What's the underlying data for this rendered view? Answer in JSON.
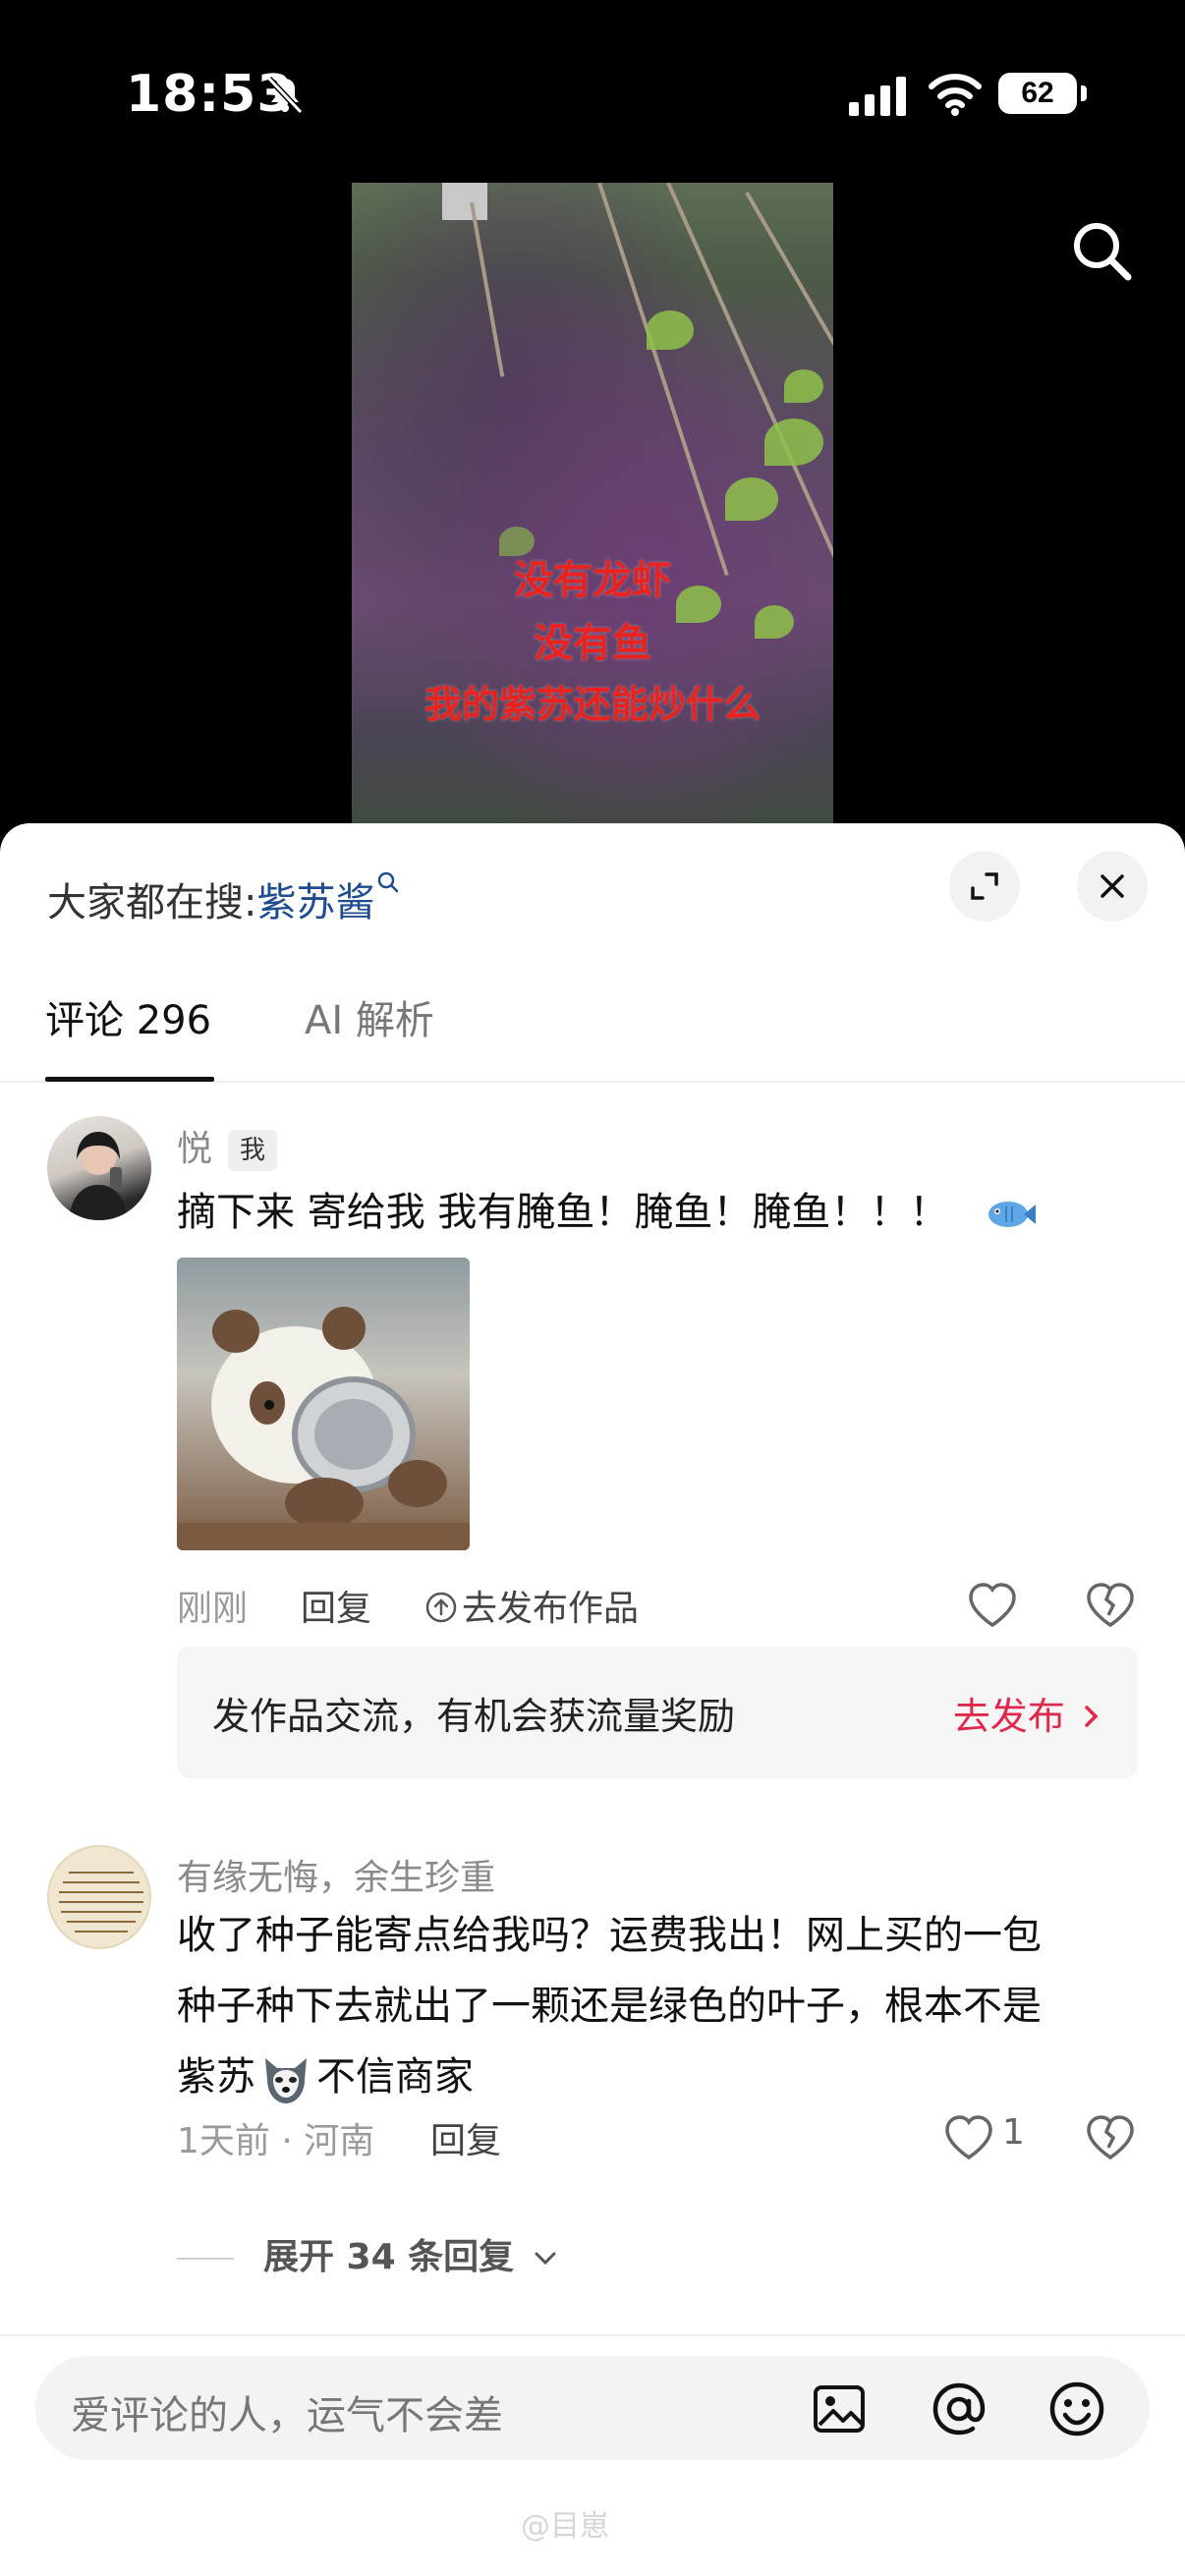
{
  "status_bar": {
    "time": "18:53",
    "battery": "62",
    "icons": [
      "bell-slash-icon",
      "cellular-signal-icon",
      "wifi-icon",
      "battery-icon"
    ]
  },
  "video": {
    "caption_lines": [
      "没有龙虾",
      "没有鱼",
      "我的紫苏还能炒什么"
    ],
    "search_icon": "search-icon"
  },
  "sheet": {
    "hot_search_label": "大家都在搜:",
    "hot_search_keyword": "紫苏酱",
    "expand_icon": "expand-icon",
    "close_icon": "close-icon"
  },
  "tabs": [
    {
      "label": "评论 296",
      "active": true
    },
    {
      "label": "AI 解析",
      "active": false
    }
  ],
  "comments": [
    {
      "user": "悦",
      "badge": "我",
      "text": "摘下来 寄给我 我有腌鱼！腌鱼！腌鱼！！！",
      "emoji": "fish-emoji",
      "has_sticker": true,
      "time": "刚刚",
      "reply_label": "回复",
      "publish_label": "去发布作品",
      "like_count": ""
    },
    {
      "user": "有缘无悔，余生珍重",
      "text_lines": [
        "收了种子能寄点给我吗？运费我出！网上买的一包",
        "种子种下去就出了一颗还是绿色的叶子，根本不是",
        "不信商家"
      ],
      "line3_prefix": "紫苏",
      "emoji": "husky-emoji",
      "time": "1天前 · 河南",
      "reply_label": "回复",
      "like_count": "1",
      "expand_label": "展开 34 条回复"
    }
  ],
  "promo": {
    "text": "发作品交流，有机会获流量奖励",
    "button": "去发布"
  },
  "input": {
    "placeholder": "爱评论的人，运气不会差",
    "icons": [
      "image-icon",
      "at-icon",
      "emoji-icon"
    ]
  },
  "watermark": "@目崽"
}
